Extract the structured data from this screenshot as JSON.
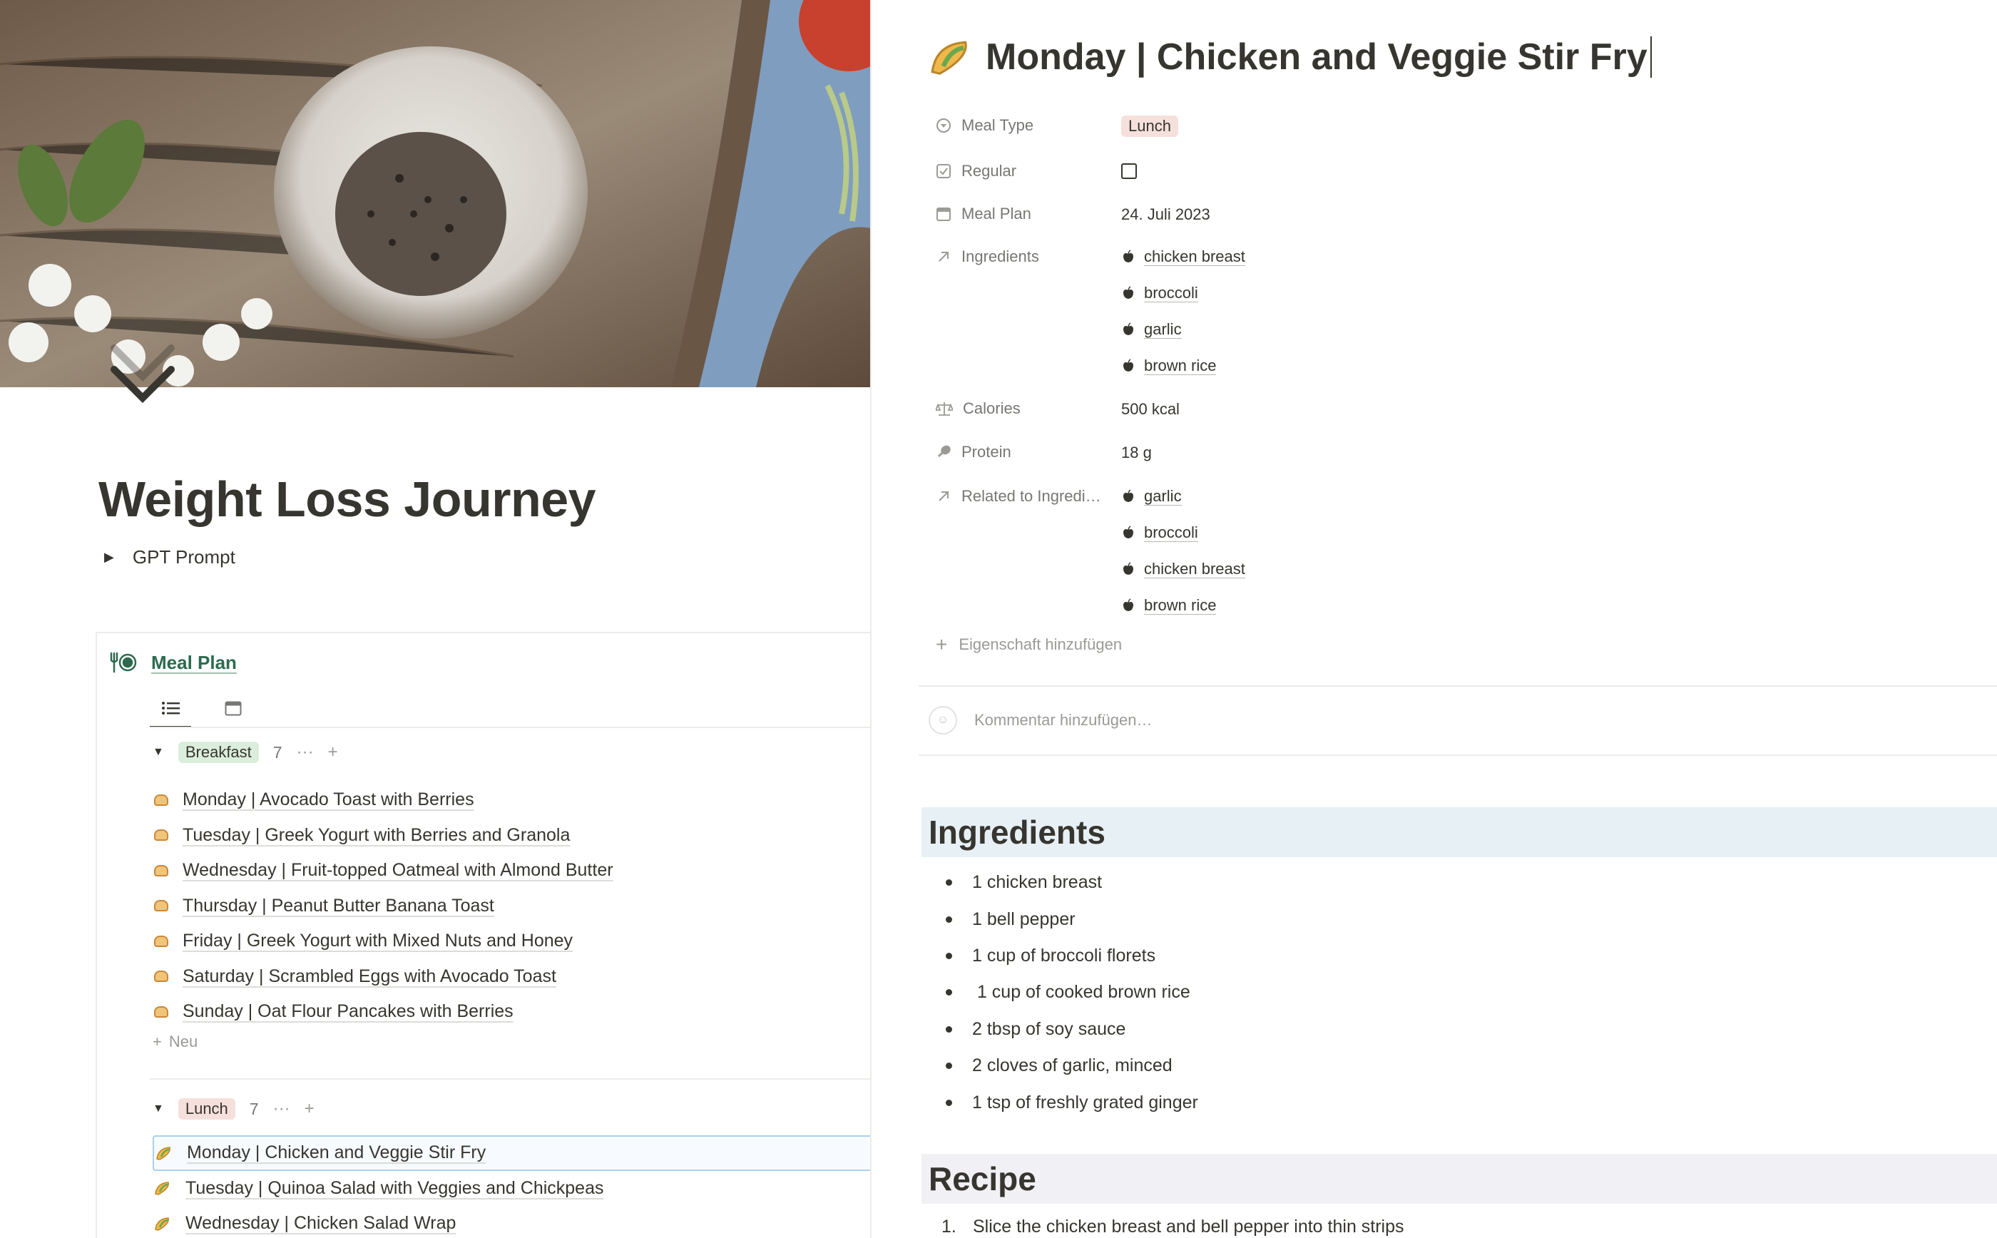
{
  "left_page": {
    "title": "Weight Loss Journey",
    "toggle_label": "GPT Prompt",
    "database": {
      "title": "Meal Plan",
      "views": [
        "list-icon",
        "calendar-icon"
      ],
      "groups": [
        {
          "tag": "Breakfast",
          "tag_color": "#dbeddb",
          "count": "7",
          "items": [
            "Monday | Avocado Toast with Berries",
            "Tuesday | Greek Yogurt with Berries and Granola",
            "Wednesday | Fruit-topped Oatmeal with Almond Butter",
            "Thursday | Peanut Butter Banana Toast",
            "Friday | Greek Yogurt with Mixed Nuts and Honey",
            "Saturday | Scrambled Eggs with Avocado Toast",
            "Sunday | Oat Flour Pancakes with Berries"
          ],
          "new_label": "Neu"
        },
        {
          "tag": "Lunch",
          "tag_color": "#f6e0dc",
          "count": "7",
          "items": [
            "Monday | Chicken and Veggie Stir Fry",
            "Tuesday | Quinoa Salad with Veggies and Chickpeas",
            "Wednesday | Chicken Salad Wrap"
          ],
          "selected_index": 0
        }
      ]
    }
  },
  "detail": {
    "title": "Monday | Chicken and Veggie Stir Fry",
    "properties": {
      "meal_type": {
        "label": "Meal Type",
        "value": "Lunch"
      },
      "regular": {
        "label": "Regular",
        "checked": false
      },
      "meal_plan": {
        "label": "Meal Plan",
        "value": "24. Juli 2023"
      },
      "ingredients": {
        "label": "Ingredients",
        "values": [
          "chicken breast",
          "broccoli",
          "garlic",
          "brown rice"
        ]
      },
      "calories": {
        "label": "Calories",
        "value": "500 kcal"
      },
      "protein": {
        "label": "Protein",
        "value": "18 g"
      },
      "related": {
        "label": "Related to Ingredi…",
        "values": [
          "garlic",
          "broccoli",
          "chicken breast",
          "brown rice"
        ]
      }
    },
    "add_property_label": "Eigenschaft hinzufügen",
    "comment_placeholder": "Kommentar hinzufügen…",
    "ingredients_heading": "Ingredients",
    "ingredients_list": [
      "1 chicken breast",
      "1 bell pepper",
      "1 cup of broccoli florets",
      " 1 cup of cooked brown rice",
      "2 tbsp of soy sauce",
      "2 cloves of garlic, minced",
      "1 tsp of freshly grated ginger"
    ],
    "recipe_heading": "Recipe",
    "recipe_steps": [
      {
        "num": "1.",
        "text": "Slice the chicken breast and bell pepper into thin strips"
      }
    ]
  }
}
